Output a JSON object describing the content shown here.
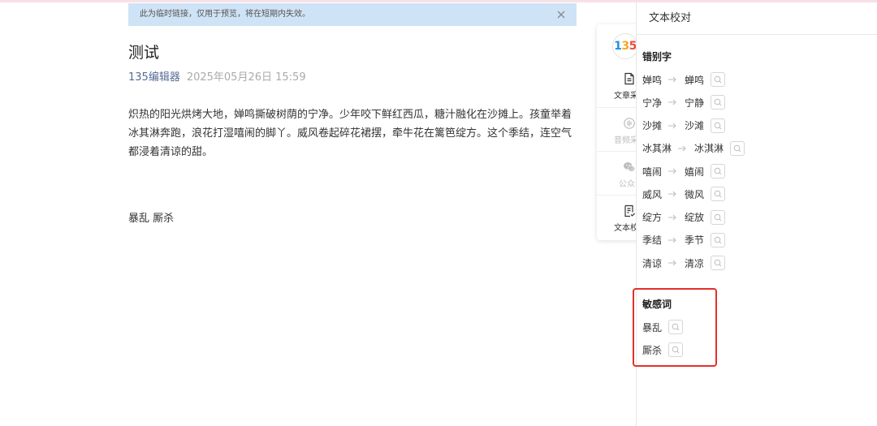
{
  "colors": {
    "top_strip": "#f7e1e7",
    "notice_bg": "#cfe3f6",
    "author_link": "#576b95",
    "highlight_border": "#e3302b",
    "disabled": "#bcbcbc"
  },
  "notice": {
    "text": "此为临时链接，仅用于预览，将在短期内失效。",
    "close_icon": "close-icon"
  },
  "article": {
    "title": "测试",
    "author": "135编辑器",
    "date": "2025年05月26日 15:59",
    "paragraphs": [
      "炽热的阳光烘烤大地，婵鸣撕破树荫的宁净。少年咬下鲜红西瓜，糖汁融化在沙摊上。孩童举着冰其淋奔跑，浪花打湿嘻闹的脚丫。威风卷起碎花裙摆，牵牛花在篱笆绽方。这个季结，连空气都浸着清谅的甜。",
      "暴乱 厮杀"
    ]
  },
  "toolbar": {
    "logo": "135",
    "items": [
      {
        "label": "文章采",
        "icon": "document-icon",
        "enabled": true
      },
      {
        "label": "音频采",
        "icon": "audio-icon",
        "enabled": false
      },
      {
        "label": "公众",
        "icon": "wechat-icon",
        "enabled": false
      },
      {
        "label": "文本校",
        "icon": "proofread-icon",
        "enabled": true
      }
    ]
  },
  "panel": {
    "title": "文本校对",
    "typos": {
      "heading": "错别字",
      "arrow_icon": "arrow-right-icon",
      "search_icon": "search-icon",
      "items": [
        {
          "wrong": "婵鸣",
          "correct": "蝉鸣"
        },
        {
          "wrong": "宁净",
          "correct": "宁静"
        },
        {
          "wrong": "沙摊",
          "correct": "沙滩"
        },
        {
          "wrong": "冰其淋",
          "correct": "冰淇淋"
        },
        {
          "wrong": "嘻闹",
          "correct": "嬉闹"
        },
        {
          "wrong": "威风",
          "correct": "微风"
        },
        {
          "wrong": "绽方",
          "correct": "绽放"
        },
        {
          "wrong": "季结",
          "correct": "季节"
        },
        {
          "wrong": "清谅",
          "correct": "清凉"
        }
      ]
    },
    "sensitive": {
      "heading": "敏感词",
      "items": [
        {
          "word": "暴乱"
        },
        {
          "word": "厮杀"
        }
      ]
    }
  }
}
